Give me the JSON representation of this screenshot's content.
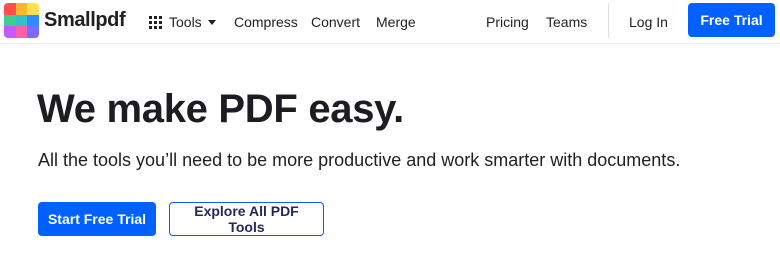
{
  "brand": {
    "name": "Smallpdf",
    "logo_colors": [
      "#ff4f4f",
      "#ffb433",
      "#ffe14d",
      "#3ccf91",
      "#2ec4c9",
      "#2f8cff",
      "#c45bff",
      "#ff5fa8",
      "#7a6bff"
    ]
  },
  "nav": {
    "tools_label": "Tools",
    "compress_label": "Compress",
    "convert_label": "Convert",
    "merge_label": "Merge",
    "pricing_label": "Pricing",
    "teams_label": "Teams",
    "login_label": "Log In",
    "free_trial_label": "Free Trial"
  },
  "hero": {
    "title": "We make PDF easy.",
    "subtitle": "All the tools you’ll need to be more productive and work smarter with documents.",
    "primary_cta": "Start Free Trial",
    "secondary_cta": "Explore All PDF Tools"
  },
  "colors": {
    "accent": "#0061fe",
    "text": "#1f1f24"
  }
}
